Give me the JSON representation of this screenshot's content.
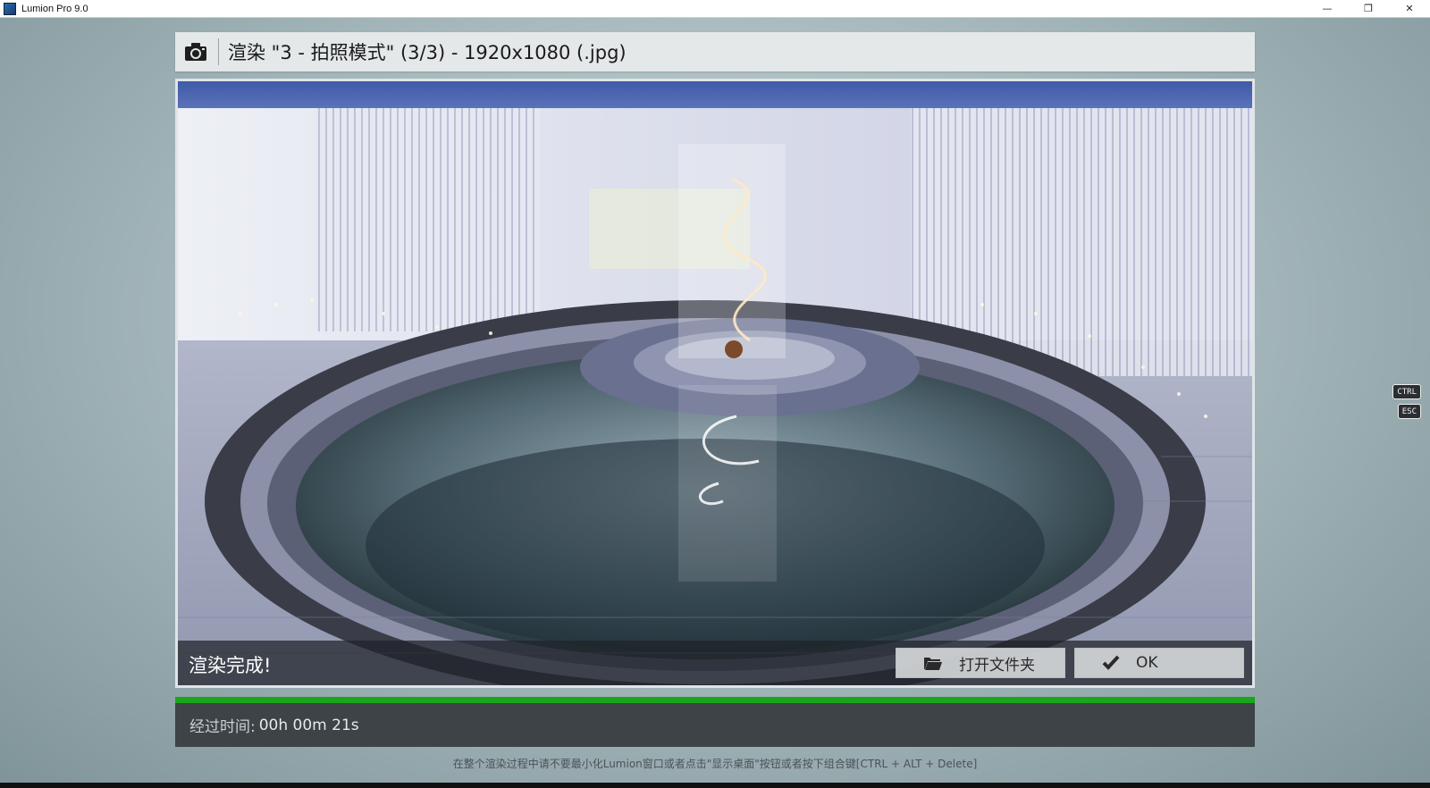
{
  "window": {
    "title": "Lumion Pro 9.0",
    "controls": {
      "minimize": "—",
      "restore": "❐",
      "close": "✕"
    }
  },
  "render": {
    "title": "渲染 \"3 - 拍照模式\" (3/3) - 1920x1080 (.jpg)",
    "camera_icon": "camera-icon",
    "status": "渲染完成!",
    "buttons": {
      "open_folder": "打开文件夹",
      "ok": "OK"
    },
    "progress": 1.0,
    "progress_color": "#1aa51a",
    "elapsed_label": "经过时间:",
    "elapsed_value": "00h 00m 21s"
  },
  "footer_hint": "在整个渲染过程中请不要最小化Lumion窗口或者点击\"显示桌面\"按钮或者按下组合键[CTRL + ALT + Delete]",
  "shortcut_badges": {
    "ctrl": "CTRL",
    "esc": "ESC"
  }
}
